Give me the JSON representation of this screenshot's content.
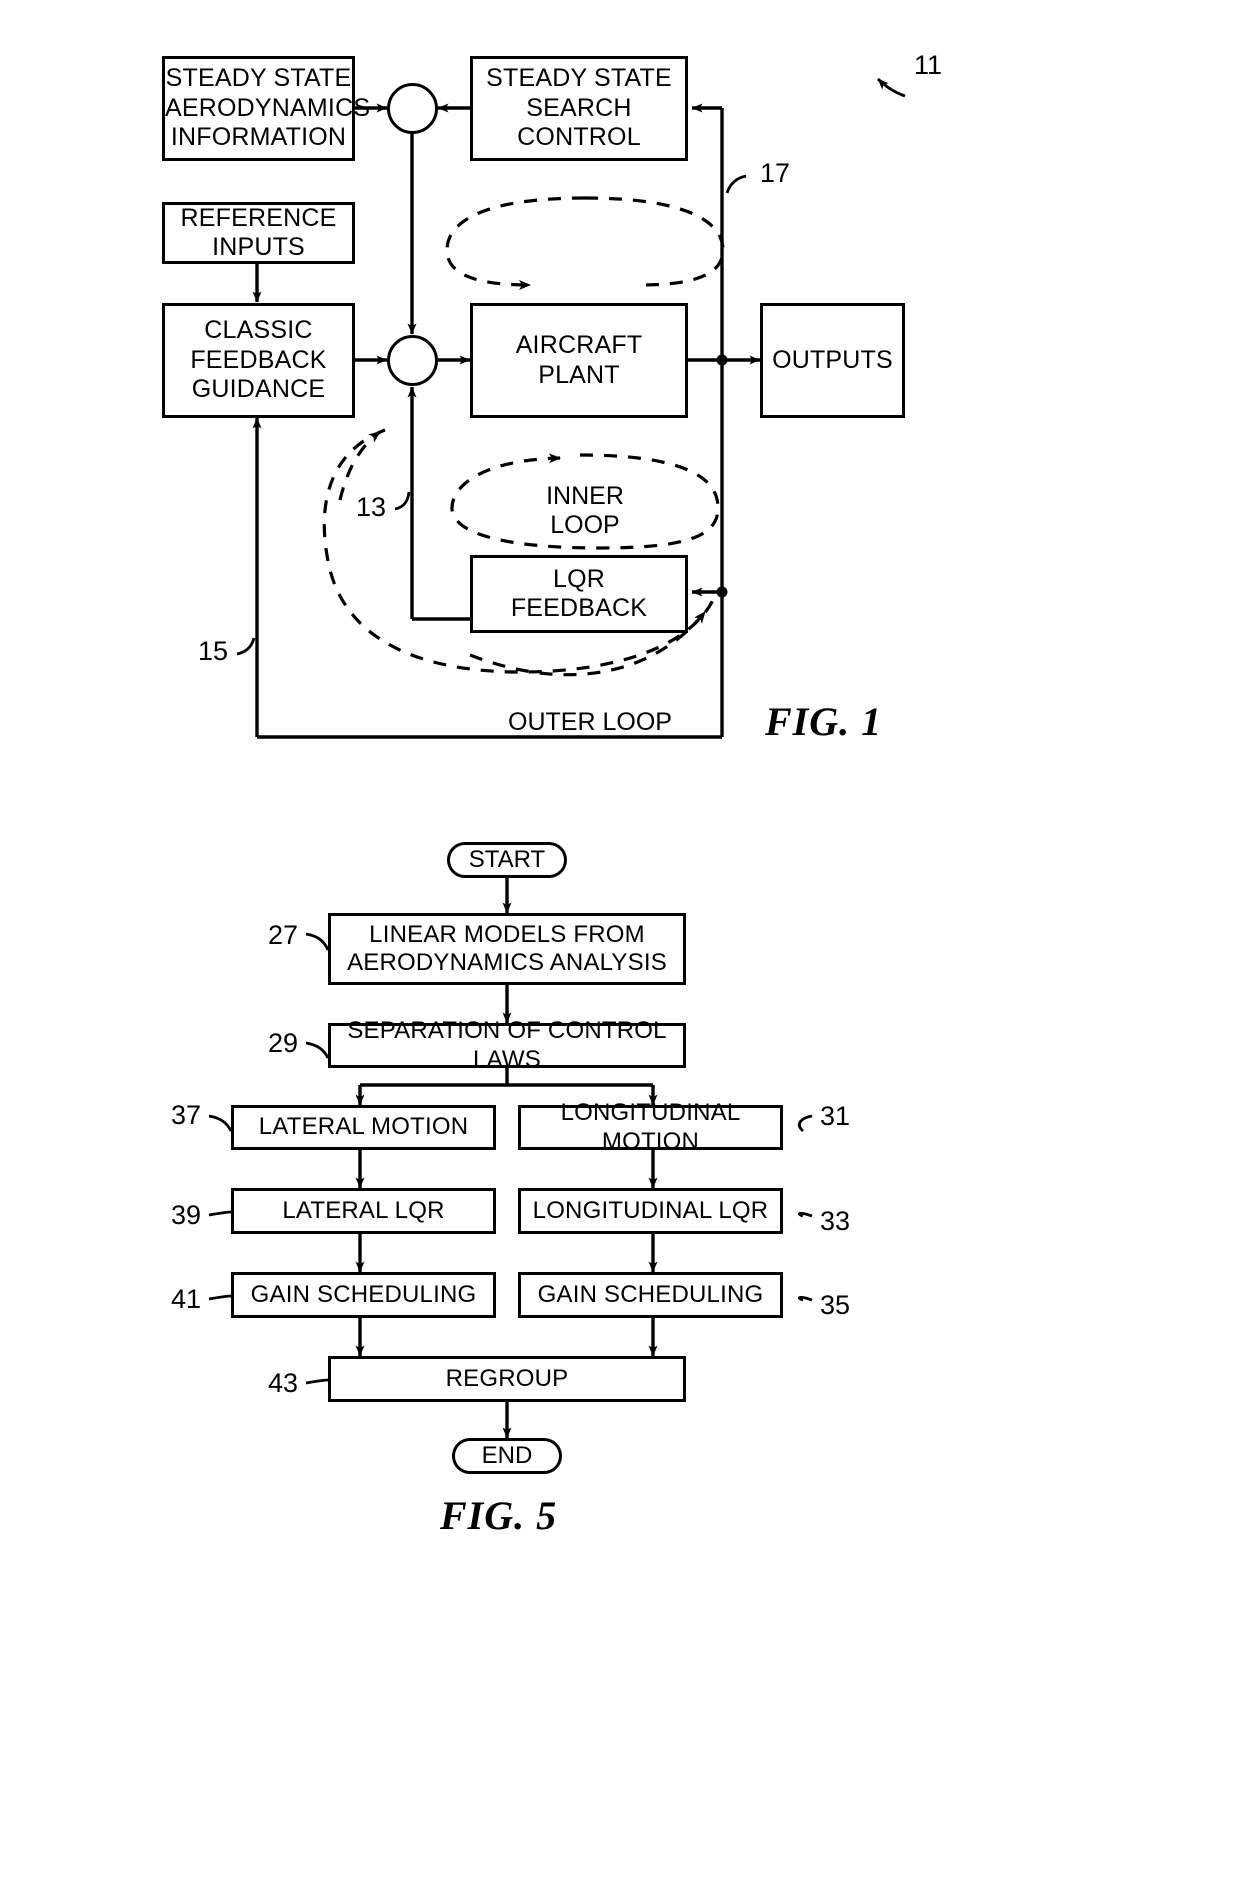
{
  "figure1": {
    "caption": "FIG. 1",
    "blocks": {
      "steady_state_aero": "STEADY STATE\nAERODYNAMICS\nINFORMATION",
      "steady_state_search": "STEADY STATE\nSEARCH\nCONTROL",
      "reference_inputs": "REFERENCE\nINPUTS",
      "classic_feedback": "CLASSIC\nFEEDBACK\nGUIDANCE",
      "aircraft_plant": "AIRCRAFT\nPLANT",
      "outputs": "OUTPUTS",
      "lqr_feedback": "LQR\nFEEDBACK"
    },
    "loop_labels": {
      "inner_loop": "INNER\nLOOP",
      "outer_loop": "OUTER LOOP"
    },
    "ref_numerals": {
      "assembly": "11",
      "outer_path": "17",
      "inner_loop": "13",
      "outer_loop": "15"
    }
  },
  "figure5": {
    "caption": "FIG. 5",
    "terminals": {
      "start": "START",
      "end": "END"
    },
    "steps": [
      {
        "id": "27",
        "label": "LINEAR MODELS FROM\nAERODYNAMICS ANALYSIS"
      },
      {
        "id": "29",
        "label": "SEPARATION OF CONTROL LAWS"
      },
      {
        "id": "37",
        "label": "LATERAL MOTION"
      },
      {
        "id": "31",
        "label": "LONGITUDINAL MOTION"
      },
      {
        "id": "39",
        "label": "LATERAL LQR"
      },
      {
        "id": "33",
        "label": "LONGITUDINAL LQR"
      },
      {
        "id": "41",
        "label": "GAIN SCHEDULING"
      },
      {
        "id": "35",
        "label": "GAIN SCHEDULING"
      },
      {
        "id": "43",
        "label": "REGROUP"
      }
    ]
  },
  "colors": {
    "ink": "#000000",
    "paper": "#ffffff"
  }
}
